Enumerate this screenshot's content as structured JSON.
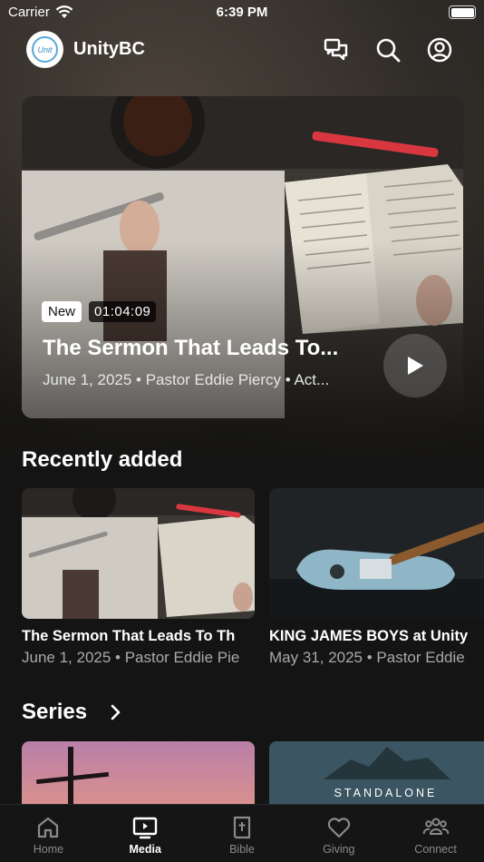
{
  "status_bar": {
    "carrier": "Carrier",
    "time": "6:39 PM"
  },
  "header": {
    "app_name": "UnityBC",
    "logo_text": "Unit"
  },
  "hero": {
    "badge": "New",
    "duration": "01:04:09",
    "title": "The Sermon That Leads To...",
    "meta": "June 1, 2025 • Pastor Eddie Piercy • Act..."
  },
  "recently_added": {
    "title": "Recently added",
    "items": [
      {
        "title": "The Sermon That Leads To Th",
        "meta": "June 1, 2025 • Pastor Eddie Pie"
      },
      {
        "title": "KING JAMES BOYS at Unity",
        "meta": "May 31, 2025 • Pastor Eddie"
      }
    ]
  },
  "series": {
    "title": "Series",
    "items": [
      {
        "label": ""
      },
      {
        "label": "STANDALONE"
      }
    ]
  },
  "tabs": [
    {
      "label": "Home",
      "icon": "home-icon",
      "active": false
    },
    {
      "label": "Media",
      "icon": "tv-icon",
      "active": true
    },
    {
      "label": "Bible",
      "icon": "bible-icon",
      "active": false
    },
    {
      "label": "Giving",
      "icon": "heart-icon",
      "active": false
    },
    {
      "label": "Connect",
      "icon": "people-icon",
      "active": false
    }
  ],
  "colors": {
    "background": "#141414",
    "tab_active": "#ffffff",
    "tab_inactive": "#8a8a8a",
    "pen_red": "#d8373f"
  }
}
